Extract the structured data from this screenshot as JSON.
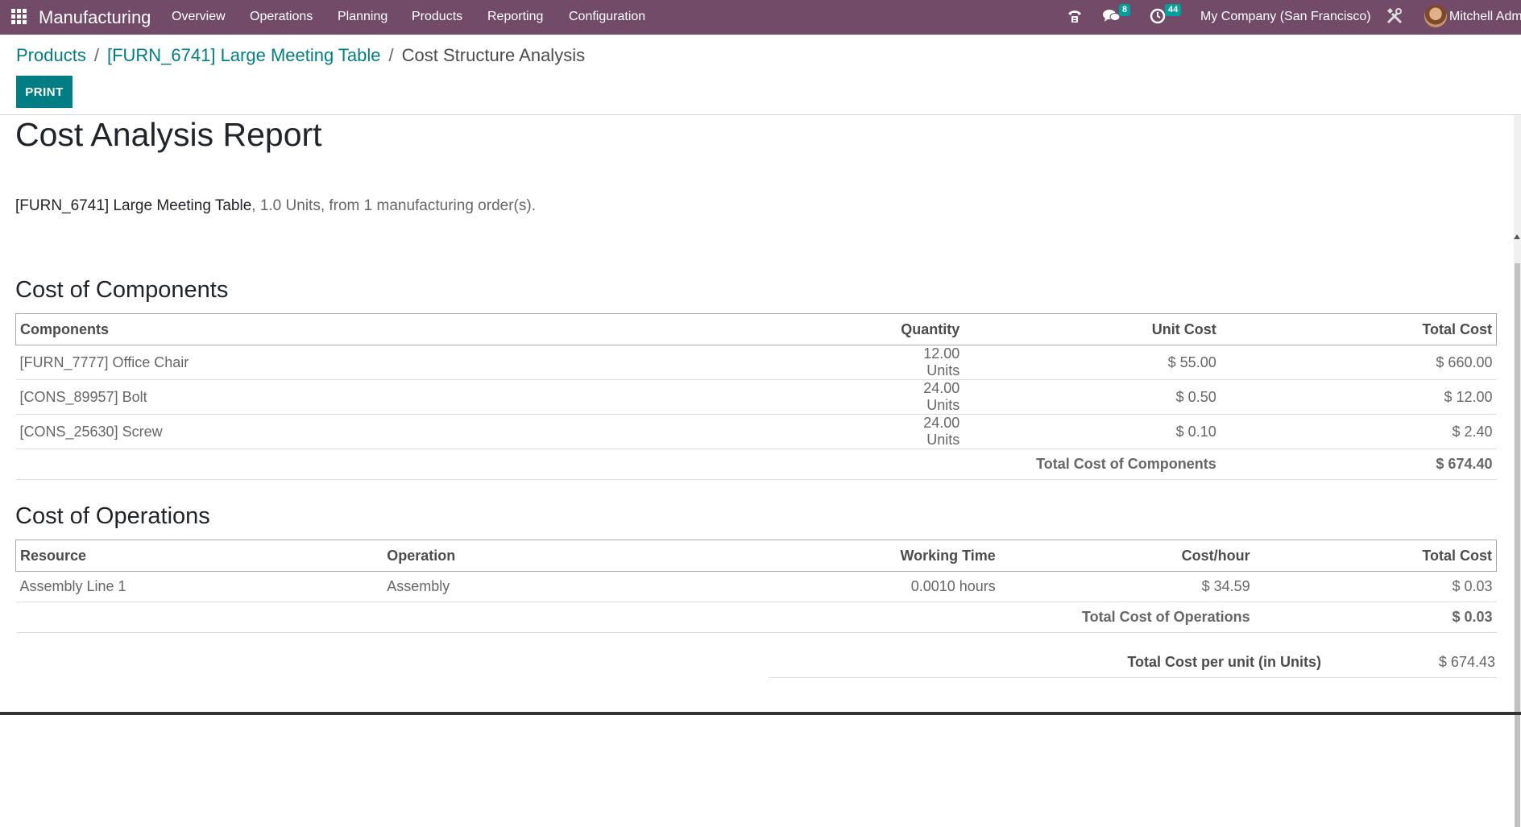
{
  "navbar": {
    "app_name": "Manufacturing",
    "menu": [
      "Overview",
      "Operations",
      "Planning",
      "Products",
      "Reporting",
      "Configuration"
    ],
    "messages_count": "8",
    "activities_count": "44",
    "company": "My Company (San Francisco)",
    "user": "Mitchell Adm",
    "icons": [
      "apps-grid-icon",
      "phone-icon",
      "chat-icon",
      "clock-icon",
      "tools-icon"
    ]
  },
  "breadcrumb": {
    "items": [
      "Products",
      "[FURN_6741] Large Meeting Table",
      "Cost Structure Analysis"
    ],
    "separator": "/"
  },
  "print_label": "PRINT",
  "report": {
    "title": "Cost Analysis Report",
    "product_name": "[FURN_6741] Large Meeting Table",
    "product_details": ", 1.0 Units, from 1 manufacturing order(s)."
  },
  "components": {
    "title": "Cost of Components",
    "headers": [
      "Components",
      "Quantity",
      "Unit Cost",
      "Total Cost"
    ],
    "rows": [
      {
        "name": "[FURN_7777] Office Chair",
        "qty": "12.00 Units",
        "unit_cost": "$ 55.00",
        "total": "$ 660.00"
      },
      {
        "name": "[CONS_89957] Bolt",
        "qty": "24.00 Units",
        "unit_cost": "$ 0.50",
        "total": "$ 12.00"
      },
      {
        "name": "[CONS_25630] Screw",
        "qty": "24.00 Units",
        "unit_cost": "$ 0.10",
        "total": "$ 2.40"
      }
    ],
    "total_label": "Total Cost of Components",
    "total_value": "$ 674.40"
  },
  "operations": {
    "title": "Cost of Operations",
    "headers": [
      "Resource",
      "Operation",
      "Working Time",
      "Cost/hour",
      "Total Cost"
    ],
    "rows": [
      {
        "resource": "Assembly Line 1",
        "operation": "Assembly",
        "time": "0.0010 hours",
        "cost_hour": "$ 34.59",
        "total": "$ 0.03"
      }
    ],
    "total_label": "Total Cost of Operations",
    "total_value": "$ 0.03"
  },
  "grand_total": {
    "label": "Total Cost per unit (in Units)",
    "value": "$ 674.43"
  },
  "colors": {
    "navbar": "#714b67",
    "accent": "#017e84",
    "badge": "#00a09d"
  }
}
